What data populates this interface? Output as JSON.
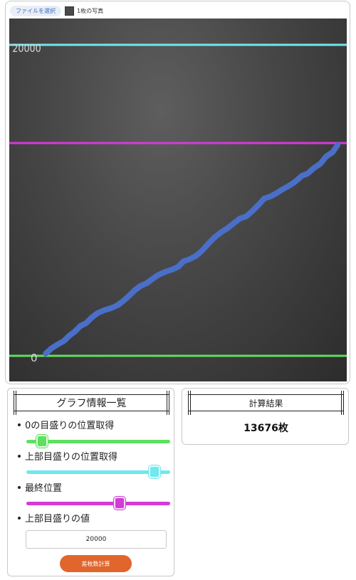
{
  "file_picker": {
    "button_label": "ファイルを選択",
    "count_label": "1枚の写真"
  },
  "graph": {
    "top_tick_label": "20000",
    "zero_tick_label": "0",
    "colors": {
      "zero_line": "#5ee05e",
      "top_line": "#6fe8ee",
      "final_line": "#d43ad8",
      "data_line": "#4a6fc9"
    }
  },
  "info_panel": {
    "title": "グラフ情報一覧",
    "zero_label": "0の目盛りの位置取得",
    "top_label": "上部目盛りの位置取得",
    "final_label": "最終位置",
    "value_label": "上部目盛りの値",
    "value_input": "20000",
    "calc_button": "差枚数計算",
    "sliders": {
      "zero_position": 0.11,
      "top_position": 0.89,
      "final_position": 0.65
    }
  },
  "result_panel": {
    "title": "計算結果",
    "value": "13676枚"
  }
}
